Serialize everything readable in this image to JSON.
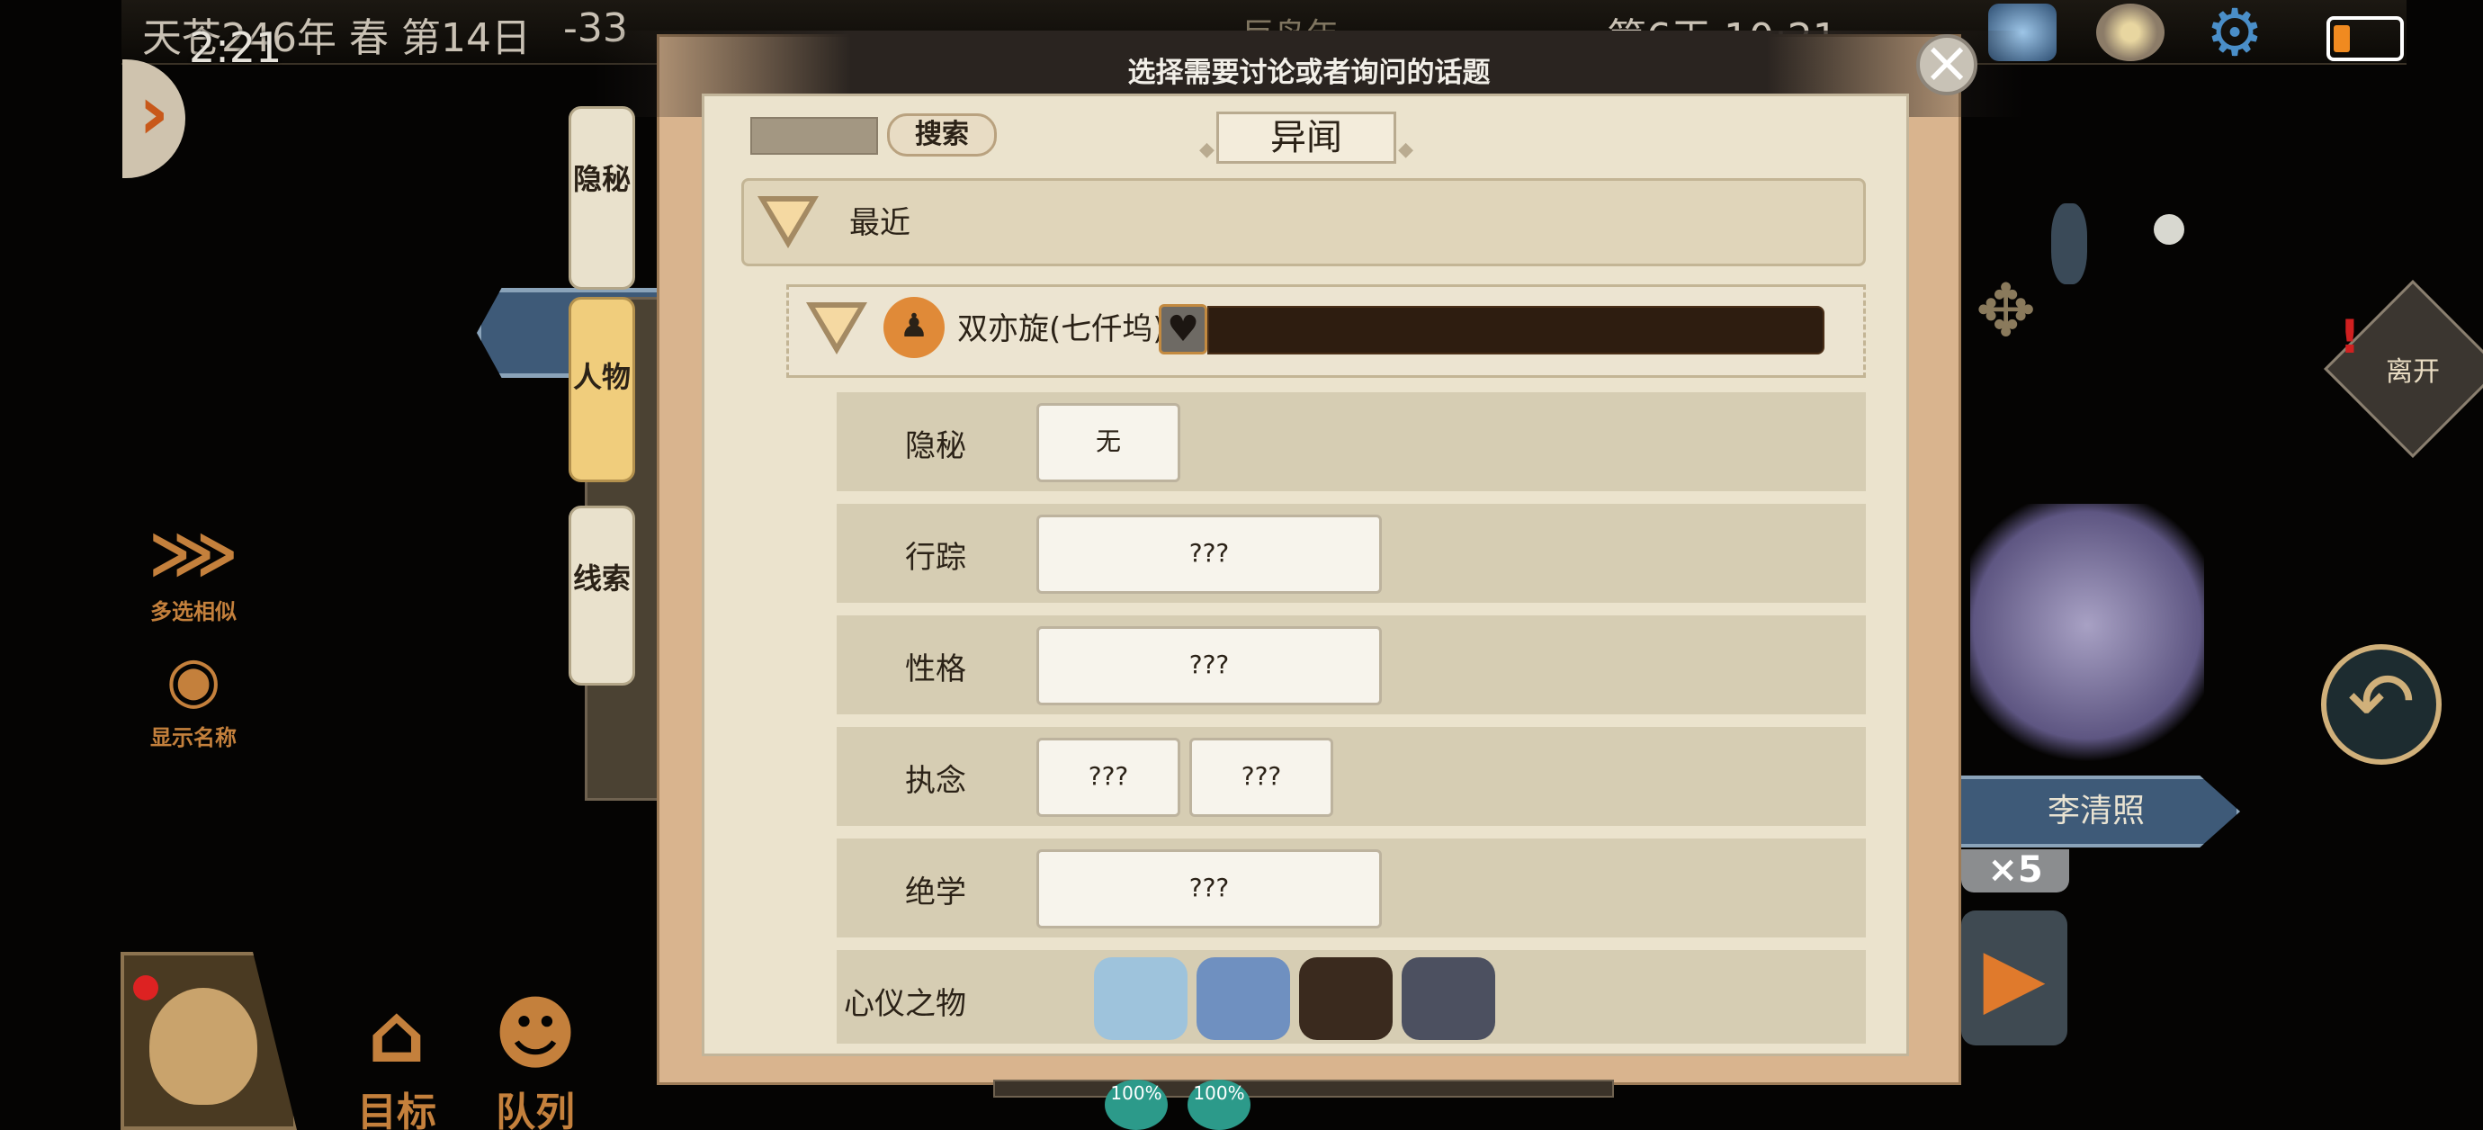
{
  "topbar": {
    "date": "天苍246年 春 第14日",
    "value": "-33",
    "center_text": "巨鸟年",
    "day_time": "第6天 10:21",
    "clock": "2:21",
    "icons": [
      "crest-icon",
      "palette-icon",
      "gear-icon",
      "battery-icon"
    ]
  },
  "left_panel": {
    "expand_icon": "chevron-right-icon",
    "multi_select": "多选相似",
    "show_names": "显示名称",
    "target": "目标",
    "queue": "队列"
  },
  "right_panel": {
    "leave": "离开",
    "npc_name": "李清照",
    "count": "×5"
  },
  "dialog": {
    "title": "选择需要讨论或者询问的话题",
    "search_label": "搜索",
    "category": "异闻",
    "side_tabs": [
      {
        "label": "隐秘",
        "active": false
      },
      {
        "label": "人物",
        "active": true
      },
      {
        "label": "线索",
        "active": false
      }
    ],
    "recent_label": "最近",
    "person": {
      "name": "双亦旋(七仟坞)",
      "heart_icon": "heart-icon"
    },
    "rows": [
      {
        "label": "隐秘",
        "values": [
          "无"
        ]
      },
      {
        "label": "行踪",
        "values": [
          "???"
        ]
      },
      {
        "label": "性格",
        "values": [
          "???"
        ]
      },
      {
        "label": "执念",
        "values": [
          "???",
          "???"
        ]
      },
      {
        "label": "绝学",
        "values": [
          "???"
        ]
      },
      {
        "label": "心仪之物",
        "items": [
          "light-blue-robe-icon",
          "blue-fur-robe-icon",
          "brown-armor-icon",
          "grey-armor-icon"
        ]
      }
    ]
  },
  "footer": {
    "pct1": "100%",
    "pct2": "100%"
  },
  "colors": {
    "accent": "#c4803c",
    "panel": "#ebe3cd",
    "row": "#d6cdb3",
    "heart_bar": "#2e1d10"
  }
}
